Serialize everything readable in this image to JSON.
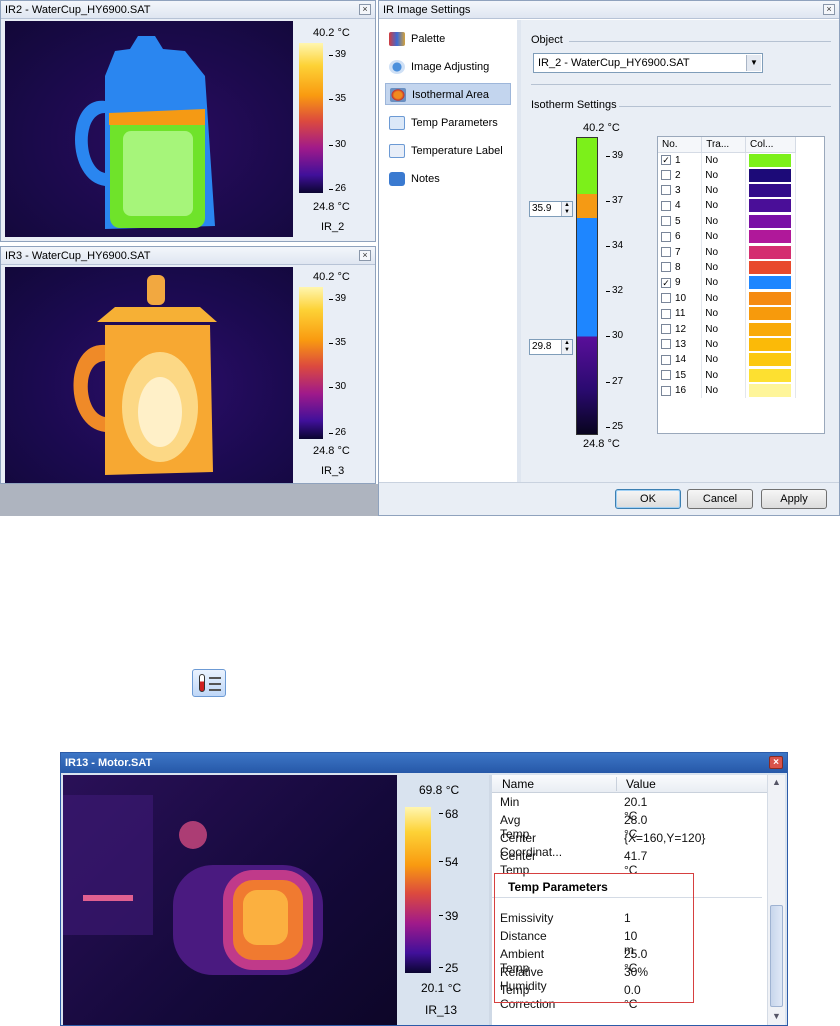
{
  "window_ir2": {
    "title": "IR2 - WaterCup_HY6900.SAT",
    "close": "×",
    "colorbar": {
      "max": "40.2 °C",
      "min": "24.8 °C",
      "ticks": [
        "39",
        "35",
        "30",
        "26"
      ],
      "label": "IR_2"
    }
  },
  "window_ir3": {
    "title": "IR3 - WaterCup_HY6900.SAT",
    "close": "×",
    "colorbar": {
      "max": "40.2 °C",
      "min": "24.8 °C",
      "ticks": [
        "39",
        "35",
        "30",
        "26"
      ],
      "label": "IR_3"
    }
  },
  "settings_dialog": {
    "title": "IR Image Settings",
    "close": "×",
    "nav": [
      {
        "label": "Palette",
        "icon": "palette-icon"
      },
      {
        "label": "Image Adjusting",
        "icon": "image-adjust-icon"
      },
      {
        "label": "Isothermal Area",
        "icon": "isothermal-icon",
        "selected": true
      },
      {
        "label": "Temp Parameters",
        "icon": "temp-parameters-icon"
      },
      {
        "label": "Temperature Label",
        "icon": "temperature-label-icon"
      },
      {
        "label": "Notes",
        "icon": "notes-icon"
      }
    ],
    "object_label": "Object",
    "object_value": "IR_2 - WaterCup_HY6900.SAT",
    "isotherm_label": "Isotherm Settings",
    "scale": {
      "max": "40.2 °C",
      "min": "24.8 °C",
      "ticks": [
        "39",
        "37",
        "34",
        "32",
        "30",
        "27",
        "25"
      ]
    },
    "upper_value": "35.9",
    "lower_value": "29.8",
    "table_headers": [
      "No.",
      "Tra...",
      "Col..."
    ],
    "rows": [
      {
        "no": "1",
        "tra": "No",
        "checked": true,
        "color": "#7cf01a"
      },
      {
        "no": "2",
        "tra": "No",
        "checked": false,
        "color": "#1c0a78"
      },
      {
        "no": "3",
        "tra": "No",
        "checked": false,
        "color": "#330c8a"
      },
      {
        "no": "4",
        "tra": "No",
        "checked": false,
        "color": "#4a0e98"
      },
      {
        "no": "5",
        "tra": "No",
        "checked": false,
        "color": "#7a0fa5"
      },
      {
        "no": "6",
        "tra": "No",
        "checked": false,
        "color": "#b0189a"
      },
      {
        "no": "7",
        "tra": "No",
        "checked": false,
        "color": "#d42e70"
      },
      {
        "no": "8",
        "tra": "No",
        "checked": false,
        "color": "#e84a2c"
      },
      {
        "no": "9",
        "tra": "No",
        "checked": true,
        "color": "#1e86ff"
      },
      {
        "no": "10",
        "tra": "No",
        "checked": false,
        "color": "#f58a10"
      },
      {
        "no": "11",
        "tra": "No",
        "checked": false,
        "color": "#f79a0c"
      },
      {
        "no": "12",
        "tra": "No",
        "checked": false,
        "color": "#f9aa08"
      },
      {
        "no": "13",
        "tra": "No",
        "checked": false,
        "color": "#fbba08"
      },
      {
        "no": "14",
        "tra": "No",
        "checked": false,
        "color": "#fcc810"
      },
      {
        "no": "15",
        "tra": "No",
        "checked": false,
        "color": "#fde030"
      },
      {
        "no": "16",
        "tra": "No",
        "checked": false,
        "color": "#fef59a"
      }
    ],
    "buttons": {
      "ok": "OK",
      "cancel": "Cancel",
      "apply": "Apply"
    }
  },
  "window_ir13": {
    "title": "IR13 - Motor.SAT",
    "close": "×",
    "colorbar": {
      "max": "69.8 °C",
      "min": "20.1 °C",
      "ticks": [
        "68",
        "54",
        "39",
        "25"
      ],
      "label": "IR_13"
    },
    "props_headers": {
      "name": "Name",
      "value": "Value"
    },
    "props": [
      {
        "name": "Min",
        "value": "20.1 °C"
      },
      {
        "name": "Avg Temp",
        "value": "28.0 °C"
      },
      {
        "name": "Center Coordinat...",
        "value": "{X=160,Y=120}"
      },
      {
        "name": "Center Temp",
        "value": "41.7 °C"
      }
    ],
    "section_title": "Temp Parameters",
    "temp_params": [
      {
        "name": "Emissivity",
        "value": "1"
      },
      {
        "name": "Distance",
        "value": "10 m"
      },
      {
        "name": "Ambient Temp",
        "value": "25.0 °C"
      },
      {
        "name": "Relative Humidity",
        "value": "30%"
      },
      {
        "name": "Temp Correction",
        "value": "0.0 °C"
      }
    ]
  }
}
